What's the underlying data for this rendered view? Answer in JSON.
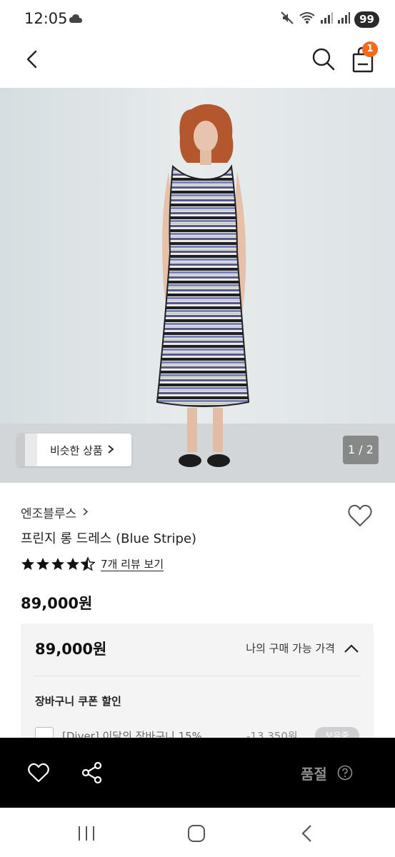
{
  "status_bar": {
    "time": "12:05",
    "battery": "99",
    "icons": [
      "cloud-icon",
      "mute-icon",
      "wifi-icon",
      "signal-icon",
      "signal-icon"
    ]
  },
  "header": {
    "back_icon": "chevron-left-icon",
    "search_icon": "search-icon",
    "cart_icon": "shopping-bag-icon",
    "cart_count": "1"
  },
  "gallery": {
    "similar_label": "비슷한 상품",
    "page_indicator": "1 / 2"
  },
  "product": {
    "brand": "엔조블루스",
    "name": "프린지 롱 드레스 (Blue Stripe)",
    "rating": 4.5,
    "review_link": "7개 리뷰 보기",
    "price": "89,000원"
  },
  "price_box": {
    "price": "89,000원",
    "toggle_label": "나의 구매 가능 가격",
    "coupon_heading": "장바구니 쿠폰 할인",
    "coupon_label": "[Diver] 이달의 장바구니 15%",
    "coupon_amount": "-13,350원",
    "coupon_pill": "보유중"
  },
  "action_bar": {
    "soldout_label": "품절"
  },
  "colors": {
    "accent_badge": "#f26a1b",
    "action_bar_bg": "#000000"
  }
}
